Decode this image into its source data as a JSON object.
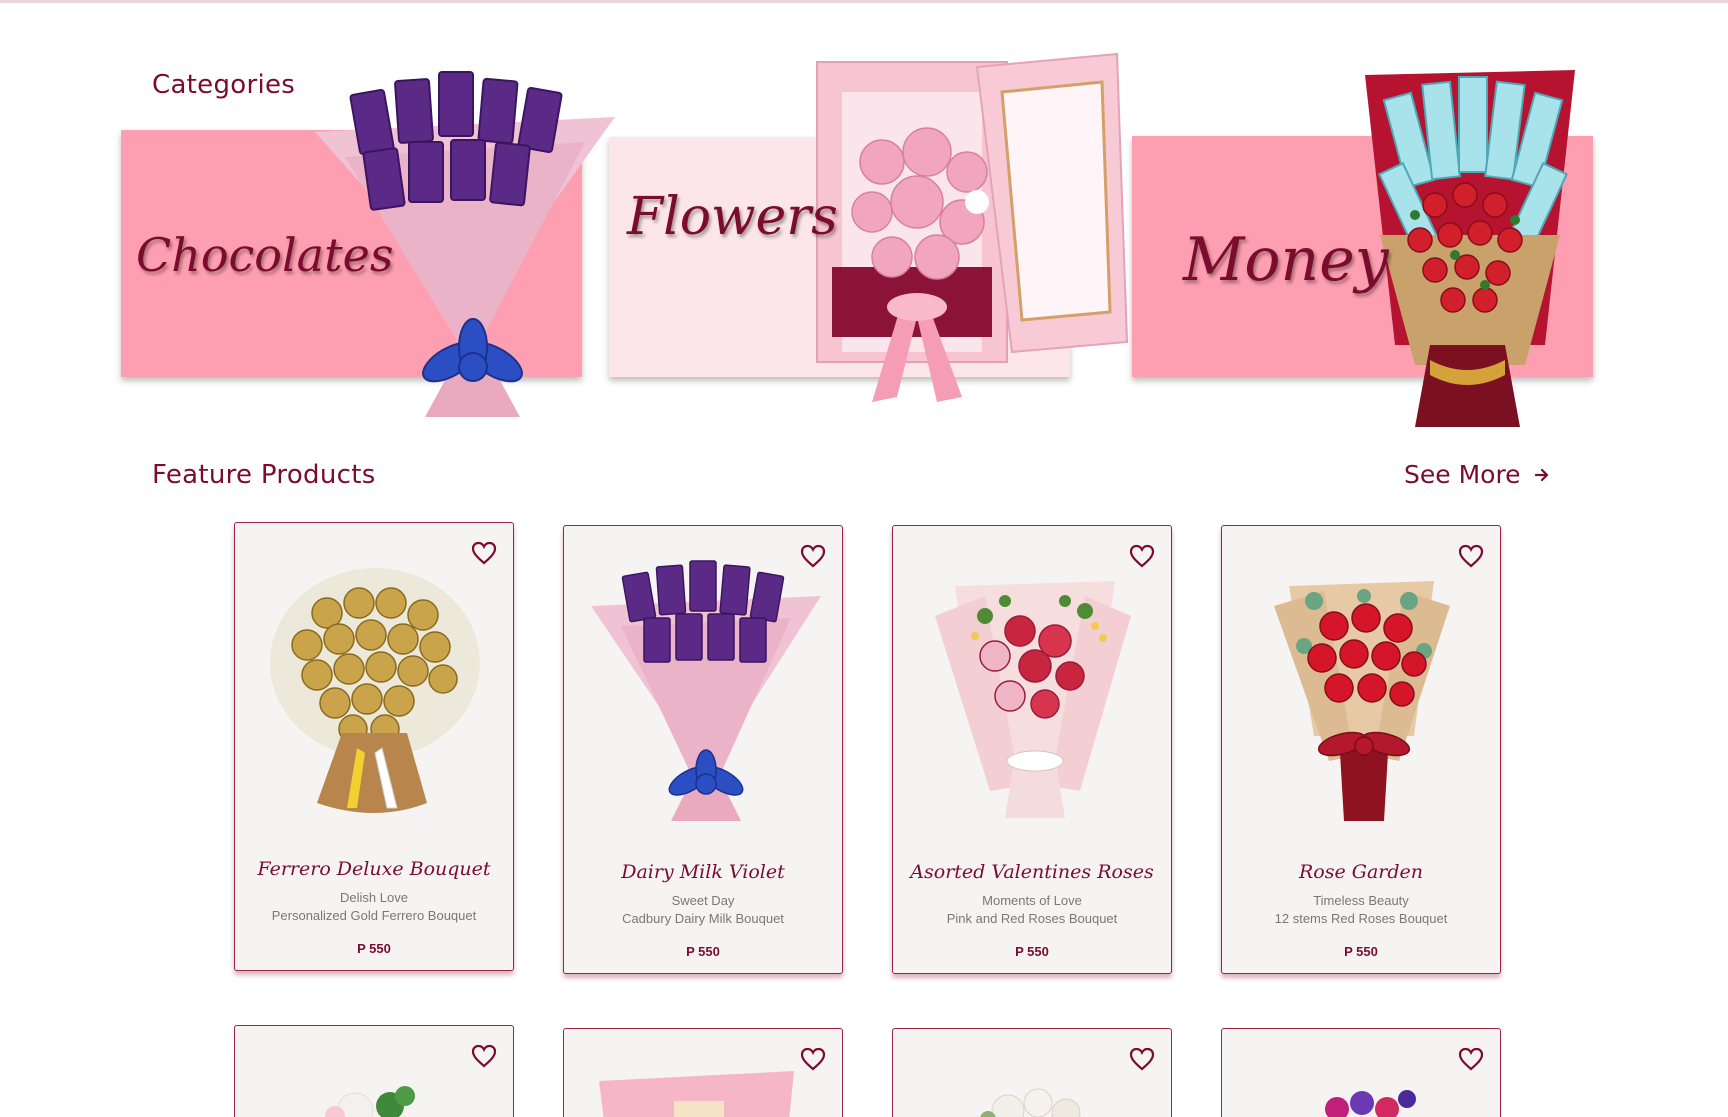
{
  "categories": {
    "title": "Categories",
    "items": [
      {
        "label": "Chocolates",
        "bg": "#fd9fb0"
      },
      {
        "label": "Flowers",
        "bg": "#fde6ea"
      },
      {
        "label": "Money",
        "bg": "#fd9fb0"
      }
    ]
  },
  "featured": {
    "title": "Feature Products",
    "see_more_label": "See More",
    "products": [
      {
        "name": "Ferrero Deluxe Bouquet",
        "subtitle": "Delish Love",
        "description": "Personalized Gold Ferrero Bouquet",
        "price": "P 550",
        "image_icon": "ferrero-bouquet-icon"
      },
      {
        "name": "Dairy Milk Violet",
        "subtitle": "Sweet Day",
        "description": "Cadbury Dairy Milk Bouquet",
        "price": "P 550",
        "image_icon": "chocolate-bouquet-icon"
      },
      {
        "name": "Asorted Valentines Roses",
        "subtitle": "Moments of Love",
        "description": "Pink and Red Roses Bouquet",
        "price": "P 550",
        "image_icon": "rose-bouquet-icon"
      },
      {
        "name": "Rose Garden",
        "subtitle": "Timeless Beauty",
        "description": "12 stems Red Roses Bouquet",
        "price": "P 550",
        "image_icon": "red-rose-bouquet-icon"
      }
    ]
  },
  "colors": {
    "primary": "#7a0c2e",
    "pink": "#fd9fb0",
    "light_pink": "#fde6ea",
    "card_bg": "#f6f4f3",
    "muted_text": "#807575"
  }
}
